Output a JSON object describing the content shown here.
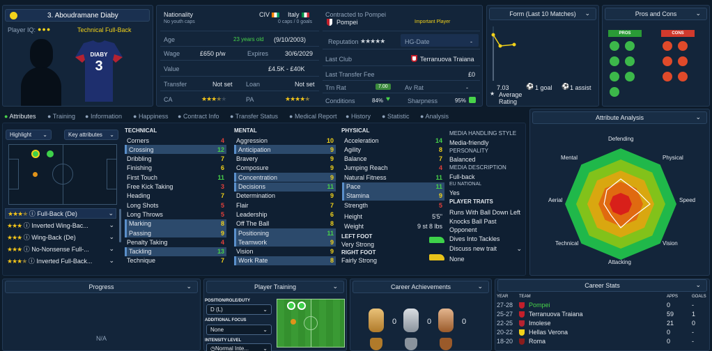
{
  "player": {
    "name": "3. Aboudramane Diaby",
    "iq_label": "Player IQ:",
    "role": "Technical Full-Back",
    "shirt_name": "DIABY",
    "shirt_number": "3"
  },
  "info": {
    "nationality_label": "Nationality",
    "nationality_sub": "No youth caps",
    "nat1_code": "CIV",
    "nat2_name": "Italy",
    "nat2_sub": "0 caps / 0 goals",
    "age_label": "Age",
    "age_value": "23 years old",
    "dob": "(9/10/2003)",
    "wage_label": "Wage",
    "wage_value": "£650 p/w",
    "expires_label": "Expires",
    "expires_value": "30/6/2029",
    "value_label": "Value",
    "value_value": "£4.5K - £40K",
    "transfer_label": "Transfer",
    "transfer_value": "Not set",
    "loan_label": "Loan",
    "loan_value": "Not set",
    "ca_label": "CA",
    "pa_label": "PA"
  },
  "contract": {
    "title": "Contracted to Pompei",
    "club": "Pompei",
    "status": "Important Player",
    "reputation_label": "Reputation",
    "hg_label": "HG-Date",
    "hg_value": "-",
    "last_club_label": "Last Club",
    "last_club_value": "Terranuova Traiana",
    "last_fee_label": "Last Transfer Fee",
    "last_fee_value": "£0",
    "trn_label": "Trn Rat",
    "trn_value": "7.00",
    "av_label": "Av Rat",
    "av_value": "-",
    "cond_label": "Conditions",
    "cond_value": "84%",
    "sharp_label": "Sharpness",
    "sharp_value": "95%"
  },
  "form": {
    "title": "Form (Last 10 Matches)",
    "avg": "7.03",
    "avg_label": "Average",
    "avg_label2": "Rating",
    "goals": "1 goal",
    "assists": "1 assist"
  },
  "proscons": {
    "title": "Pros and Cons",
    "pros": "PROS",
    "cons": "CONS"
  },
  "tabs": [
    "Attributes",
    "Training",
    "Information",
    "Happiness",
    "Contract Info",
    "Transfer Status",
    "Medical Report",
    "History",
    "Statistic",
    "Analysis"
  ],
  "left": {
    "highlight": "Highlight",
    "key_attrs": "Key attributes",
    "roles": [
      "Full-Back (De)",
      "Inverted Wing-Bac...",
      "Wing-Back (De)",
      "No-Nonsense Full-...",
      "Inverted Full-Back..."
    ]
  },
  "technical": {
    "title": "TECHNICAL",
    "rows": [
      [
        "Corners",
        "4"
      ],
      [
        "Crossing",
        "12"
      ],
      [
        "Dribbling",
        "7"
      ],
      [
        "Finishing",
        "6"
      ],
      [
        "First Touch",
        "11"
      ],
      [
        "Free Kick Taking",
        "3"
      ],
      [
        "Heading",
        "7"
      ],
      [
        "Long Shots",
        "5"
      ],
      [
        "Long Throws",
        "5"
      ],
      [
        "Marking",
        "8"
      ],
      [
        "Passing",
        "9"
      ],
      [
        "Penalty Taking",
        "4"
      ],
      [
        "Tackling",
        "13"
      ],
      [
        "Technique",
        "7"
      ]
    ]
  },
  "mental": {
    "title": "MENTAL",
    "rows": [
      [
        "Aggression",
        "10"
      ],
      [
        "Anticipation",
        "9"
      ],
      [
        "Bravery",
        "9"
      ],
      [
        "Composure",
        "9"
      ],
      [
        "Concentration",
        "9"
      ],
      [
        "Decisions",
        "11"
      ],
      [
        "Determination",
        "9"
      ],
      [
        "Flair",
        "7"
      ],
      [
        "Leadership",
        "6"
      ],
      [
        "Off The Ball",
        "8"
      ],
      [
        "Positioning",
        "11"
      ],
      [
        "Teamwork",
        "9"
      ],
      [
        "Vision",
        "9"
      ],
      [
        "Work Rate",
        "8"
      ]
    ]
  },
  "physical": {
    "title": "PHYSICAL",
    "rows": [
      [
        "Acceleration",
        "14"
      ],
      [
        "Agility",
        "8"
      ],
      [
        "Balance",
        "7"
      ],
      [
        "Jumping Reach",
        "4"
      ],
      [
        "Natural Fitness",
        "11"
      ],
      [
        "Pace",
        "11"
      ],
      [
        "Stamina",
        "9"
      ],
      [
        "Strength",
        "5"
      ]
    ],
    "height_label": "Height",
    "height_value": "5'5\"",
    "weight_label": "Weight",
    "weight_value": "9 st 8 lbs",
    "left_foot_label": "LEFT FOOT",
    "left_foot_value": "Very Strong",
    "right_foot_label": "RIGHT FOOT",
    "right_foot_value": "Fairly Strong"
  },
  "media": {
    "style_label": "MEDIA HANDLING STYLE",
    "style_value": "Media-friendly",
    "personality_label": "PERSONALITY",
    "personality_value": "Balanced",
    "desc_label": "MEDIA DESCRIPTION",
    "desc_value": "Full-back",
    "eu_label": "EU NATIONAL",
    "eu_value": "Yes",
    "traits_label": "PLAYER TRAITS",
    "traits": [
      "Runs With Ball Down Left",
      "Knocks Ball Past",
      "Opponent",
      "Dives Into Tackles"
    ],
    "discuss": "Discuss new trait",
    "none": "None"
  },
  "analysis": {
    "title": "Attribute Analysis",
    "labels": {
      "defending": "Defending",
      "physical": "Physical",
      "speed": "Speed",
      "vision": "Vision",
      "attacking": "Attacking",
      "technical": "Technical",
      "aerial": "Aerial",
      "mental": "Mental"
    }
  },
  "progress": {
    "title": "Progress",
    "na": "N/A"
  },
  "training": {
    "title": "Player Training",
    "prd_label": "POSITION/ROLE/DUTY",
    "prd_value": "D (L)",
    "focus_label": "ADDITIONAL FOCUS",
    "focus_value": "None",
    "intensity_label": "INTENSITY LEVEL",
    "intensity_value": "Normal Inte..."
  },
  "achievements": {
    "title": "Career Achievements",
    "counts": [
      "0",
      "0",
      "0"
    ]
  },
  "career": {
    "title": "Career Stats",
    "col_year": "YEAR",
    "col_team": "TEAM",
    "col_apps": "APPS",
    "col_goals": "GOALS",
    "rows": [
      [
        "27-28",
        "Pompei",
        "0",
        "-"
      ],
      [
        "25-27",
        "Terranuova Traiana",
        "59",
        "1"
      ],
      [
        "22-25",
        "Imolese",
        "21",
        "0"
      ],
      [
        "20-22",
        "Hellas Verona",
        "0",
        "-"
      ],
      [
        "18-20",
        "Roma",
        "0",
        "-"
      ]
    ]
  },
  "colors": {
    "bg": "#0d1b2a",
    "panel": "#13253a",
    "highlight": "#2c4a6c",
    "green": "#48d34a",
    "yellow": "#f2d21a",
    "red": "#e2403a"
  }
}
